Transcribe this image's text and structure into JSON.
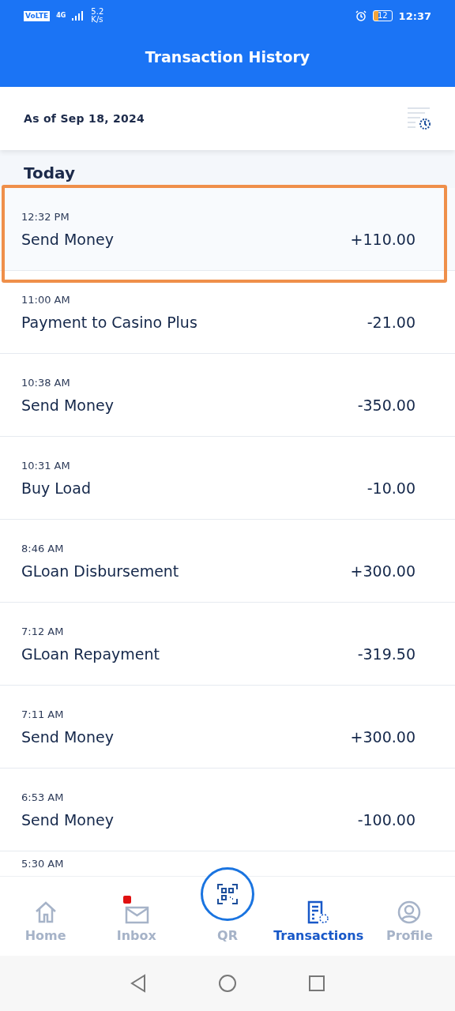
{
  "status_bar": {
    "network": "VoLTE",
    "signal_type": "4G",
    "speed": "5.2 K/s",
    "battery": "12",
    "time": "12:37"
  },
  "header": {
    "title": "Transaction History"
  },
  "date_bar": {
    "label": "As of Sep 18, 2024"
  },
  "section": {
    "title": "Today"
  },
  "transactions": [
    {
      "time": "12:32 PM",
      "name": "Send Money",
      "amount": "+110.00",
      "highlighted": true
    },
    {
      "time": "11:00 AM",
      "name": "Payment to Casino Plus",
      "amount": "-21.00",
      "highlighted": false
    },
    {
      "time": "10:38 AM",
      "name": "Send Money",
      "amount": "-350.00",
      "highlighted": false
    },
    {
      "time": "10:31 AM",
      "name": "Buy Load",
      "amount": "-10.00",
      "highlighted": false
    },
    {
      "time": "8:46 AM",
      "name": "GLoan Disbursement",
      "amount": "+300.00",
      "highlighted": false
    },
    {
      "time": "7:12 AM",
      "name": "GLoan Repayment",
      "amount": "-319.50",
      "highlighted": false
    },
    {
      "time": "7:11 AM",
      "name": "Send Money",
      "amount": "+300.00",
      "highlighted": false
    },
    {
      "time": "6:53 AM",
      "name": "Send Money",
      "amount": "-100.00",
      "highlighted": false
    },
    {
      "time": "5:30 AM"
    }
  ],
  "bottom_nav": [
    {
      "kind": "home",
      "label": "Home",
      "selected": false
    },
    {
      "kind": "inbox",
      "label": "Inbox",
      "selected": false,
      "badge": true
    },
    {
      "kind": "qr",
      "label": "QR",
      "selected": false
    },
    {
      "kind": "transactions",
      "label": "Transactions",
      "selected": true
    },
    {
      "kind": "profile",
      "label": "Profile",
      "selected": false
    }
  ]
}
